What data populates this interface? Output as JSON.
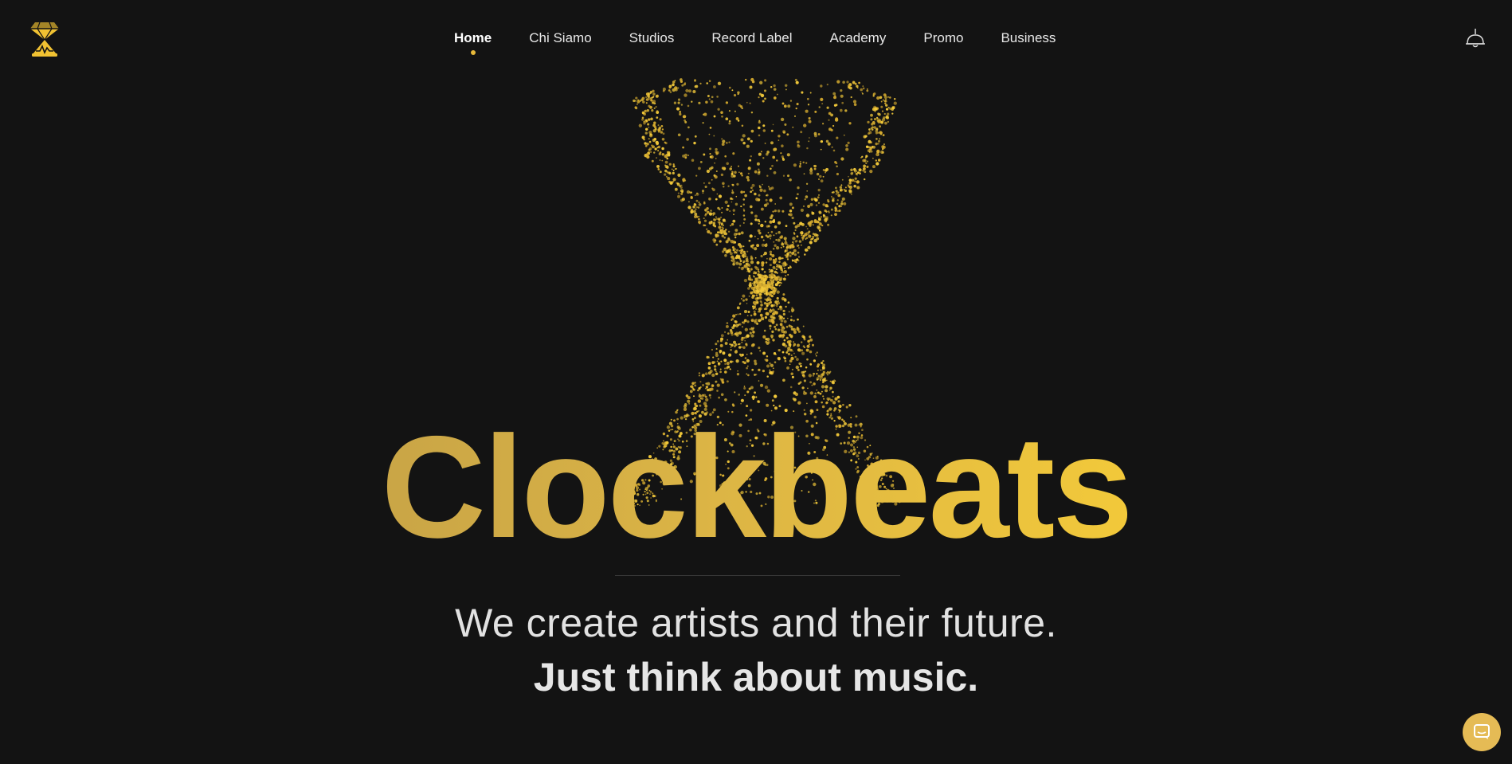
{
  "header": {
    "logo_icon": "hourglass-diamond-logo-icon",
    "nav": [
      {
        "label": "Home",
        "active": true
      },
      {
        "label": "Chi Siamo",
        "active": false
      },
      {
        "label": "Studios",
        "active": false
      },
      {
        "label": "Record Label",
        "active": false
      },
      {
        "label": "Academy",
        "active": false
      },
      {
        "label": "Promo",
        "active": false
      },
      {
        "label": "Business",
        "active": false
      }
    ],
    "right_icon": "lamp-icon"
  },
  "hero": {
    "brand": "Clockbeats",
    "tagline": "We create artists and their future.",
    "tagline_bold": "Just think about music.",
    "graphic": "particle-hourglass"
  },
  "chat": {
    "icon": "chat-bubble-icon"
  },
  "colors": {
    "background": "#131313",
    "accent": "#e8b93a",
    "brand_gradient_start": "#c9a546",
    "brand_gradient_end": "#f2c93a"
  }
}
